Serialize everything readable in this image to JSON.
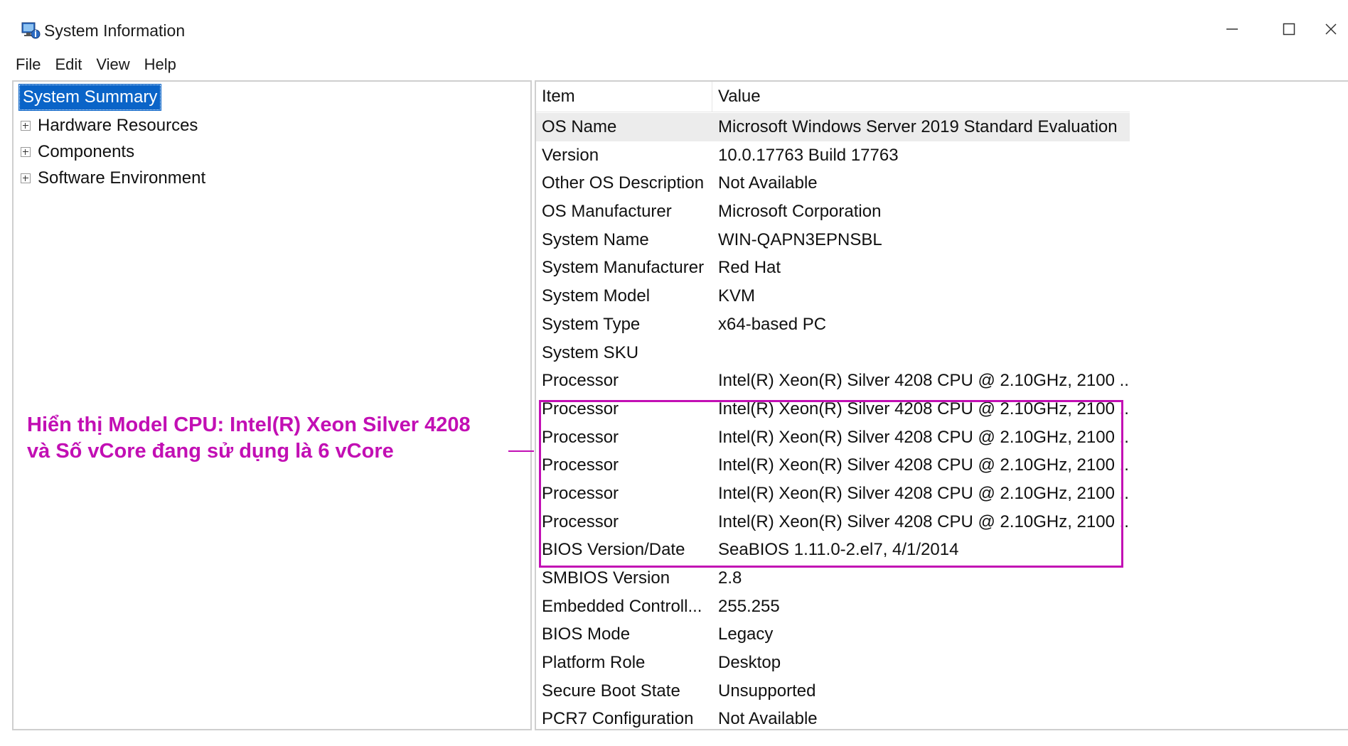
{
  "window": {
    "title": "System Information",
    "icon": "system-information-icon",
    "controls": [
      "minimize-icon",
      "maximize-icon",
      "close-icon"
    ]
  },
  "menu": {
    "items": [
      "File",
      "Edit",
      "View",
      "Help"
    ]
  },
  "tree": {
    "root": "System Summary",
    "nodes": [
      "Hardware Resources",
      "Components",
      "Software Environment"
    ]
  },
  "annotation": {
    "line1": "Hiển thị Model CPU: Intel(R) Xeon Silver 4208",
    "line2": "và Số vCore đang sử dụng là 6 vCore",
    "color": "#c20fb4"
  },
  "list": {
    "columns": [
      "Item",
      "Value"
    ],
    "rows": [
      {
        "item": "OS Name",
        "value": "Microsoft Windows Server 2019 Standard Evaluation"
      },
      {
        "item": "Version",
        "value": "10.0.17763 Build 17763"
      },
      {
        "item": "Other OS Description",
        "value": "Not Available"
      },
      {
        "item": "OS Manufacturer",
        "value": "Microsoft Corporation"
      },
      {
        "item": "System Name",
        "value": "WIN-QAPN3EPNSBL"
      },
      {
        "item": "System Manufacturer",
        "value": "Red Hat"
      },
      {
        "item": "System Model",
        "value": "KVM"
      },
      {
        "item": "System Type",
        "value": "x64-based PC"
      },
      {
        "item": "System SKU",
        "value": ""
      },
      {
        "item": "Processor",
        "value": "Intel(R) Xeon(R) Silver 4208 CPU @ 2.10GHz, 2100 ..."
      },
      {
        "item": "Processor",
        "value": "Intel(R) Xeon(R) Silver 4208 CPU @ 2.10GHz, 2100 ..."
      },
      {
        "item": "Processor",
        "value": "Intel(R) Xeon(R) Silver 4208 CPU @ 2.10GHz, 2100 ..."
      },
      {
        "item": "Processor",
        "value": "Intel(R) Xeon(R) Silver 4208 CPU @ 2.10GHz, 2100 ..."
      },
      {
        "item": "Processor",
        "value": "Intel(R) Xeon(R) Silver 4208 CPU @ 2.10GHz, 2100 ..."
      },
      {
        "item": "Processor",
        "value": "Intel(R) Xeon(R) Silver 4208 CPU @ 2.10GHz, 2100 ..."
      },
      {
        "item": "BIOS Version/Date",
        "value": "SeaBIOS 1.11.0-2.el7, 4/1/2014"
      },
      {
        "item": "SMBIOS Version",
        "value": "2.8"
      },
      {
        "item": "Embedded Controll...",
        "value": "255.255"
      },
      {
        "item": "BIOS Mode",
        "value": "Legacy"
      },
      {
        "item": "Platform Role",
        "value": "Desktop"
      },
      {
        "item": "Secure Boot State",
        "value": "Unsupported"
      },
      {
        "item": "PCR7 Configuration",
        "value": "Not Available"
      }
    ]
  },
  "colors": {
    "selection": "#0a64c8",
    "highlight": "#c20fb4",
    "selected_row": "#ececec"
  }
}
